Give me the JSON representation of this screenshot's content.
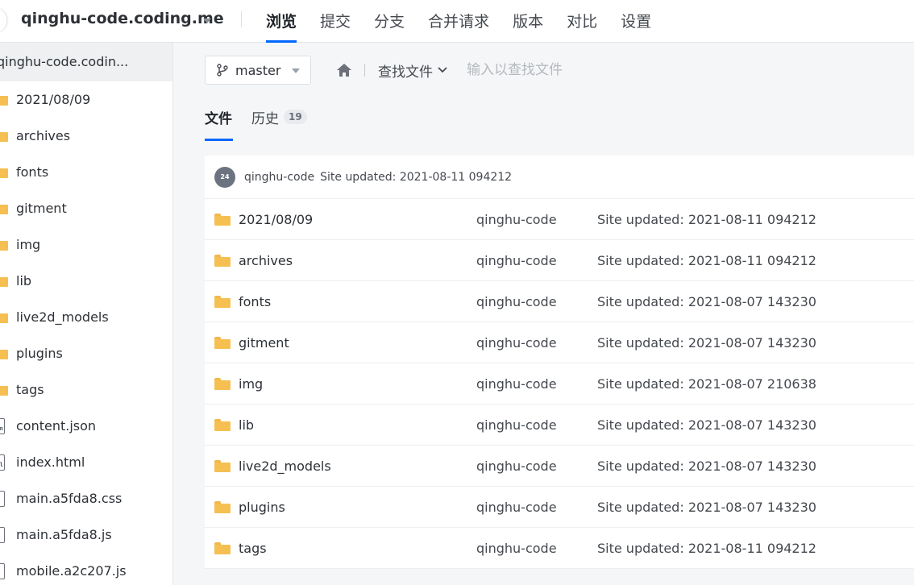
{
  "header": {
    "repo_name": "qinghu-code.coding.me",
    "nav": [
      "浏览",
      "提交",
      "分支",
      "合并请求",
      "版本",
      "对比",
      "设置"
    ],
    "active_nav": 0
  },
  "sidebar": {
    "root_label": "qinghu-code.codin...",
    "items": [
      {
        "label": "2021/08/09",
        "icon": "folder-icon"
      },
      {
        "label": "archives",
        "icon": "folder-icon"
      },
      {
        "label": "fonts",
        "icon": "folder-icon"
      },
      {
        "label": "gitment",
        "icon": "folder-icon"
      },
      {
        "label": "img",
        "icon": "folder-icon"
      },
      {
        "label": "lib",
        "icon": "folder-icon"
      },
      {
        "label": "live2d_models",
        "icon": "folder-icon"
      },
      {
        "label": "plugins",
        "icon": "folder-icon"
      },
      {
        "label": "tags",
        "icon": "folder-icon"
      },
      {
        "label": "content.json",
        "icon": "json-file-icon",
        "tag": "json"
      },
      {
        "label": "index.html",
        "icon": "html-file-icon",
        "tag": "html"
      },
      {
        "label": "main.a5fda8.css",
        "icon": "file-icon",
        "tag": ""
      },
      {
        "label": "main.a5fda8.js",
        "icon": "js-file-icon",
        "tag": "JS"
      },
      {
        "label": "mobile.a2c207.js",
        "icon": "js-file-icon",
        "tag": "JS"
      }
    ]
  },
  "toolbar": {
    "branch": "master",
    "find_label": "查找文件",
    "find_placeholder": "输入以查找文件"
  },
  "tabs": {
    "files_label": "文件",
    "history_label": "历史",
    "history_count": "19"
  },
  "latest_commit": {
    "avatar_text": "24",
    "author": "qinghu-code",
    "message": "Site updated: 2021-08-11 094212"
  },
  "files": [
    {
      "name": "2021/08/09",
      "author": "qinghu-code",
      "message": "Site updated: 2021-08-11 094212"
    },
    {
      "name": "archives",
      "author": "qinghu-code",
      "message": "Site updated: 2021-08-11 094212"
    },
    {
      "name": "fonts",
      "author": "qinghu-code",
      "message": "Site updated: 2021-08-07 143230"
    },
    {
      "name": "gitment",
      "author": "qinghu-code",
      "message": "Site updated: 2021-08-07 143230"
    },
    {
      "name": "img",
      "author": "qinghu-code",
      "message": "Site updated: 2021-08-07 210638"
    },
    {
      "name": "lib",
      "author": "qinghu-code",
      "message": "Site updated: 2021-08-07 143230"
    },
    {
      "name": "live2d_models",
      "author": "qinghu-code",
      "message": "Site updated: 2021-08-07 143230"
    },
    {
      "name": "plugins",
      "author": "qinghu-code",
      "message": "Site updated: 2021-08-07 143230"
    },
    {
      "name": "tags",
      "author": "qinghu-code",
      "message": "Site updated: 2021-08-11 094212"
    }
  ],
  "colors": {
    "accent": "#0066ff",
    "folder": "#f5c051"
  }
}
